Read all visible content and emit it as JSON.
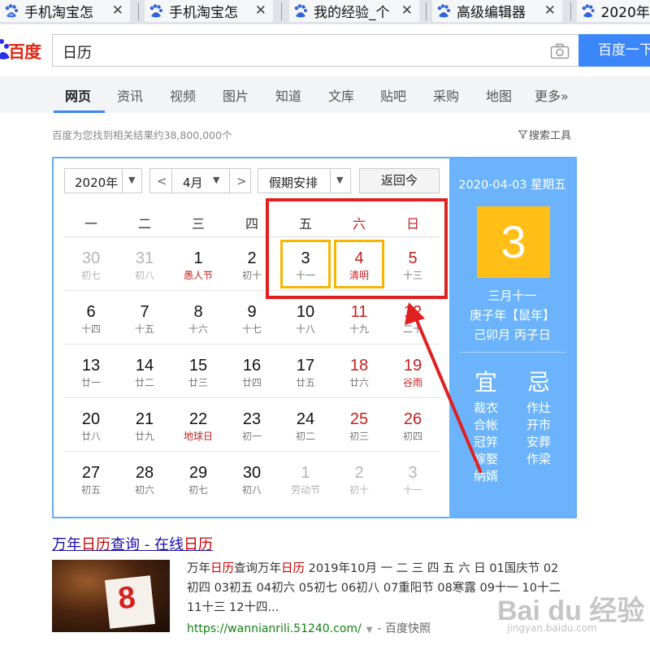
{
  "browser": {
    "tabs": [
      {
        "title": "手机淘宝怎"
      },
      {
        "title": "手机淘宝怎"
      },
      {
        "title": "我的经验_个"
      },
      {
        "title": "高级编辑器"
      },
      {
        "title": "2020年"
      }
    ],
    "tab_close": "✕"
  },
  "header": {
    "logo_text": "百度",
    "search_value": "日历",
    "search_button": "百度一下"
  },
  "nav": {
    "items": [
      "网页",
      "资讯",
      "视频",
      "图片",
      "知道",
      "文库",
      "贴吧",
      "采购",
      "地图",
      "更多»"
    ]
  },
  "results": {
    "count_text": "百度为您找到相关结果约38,800,000个",
    "tools_label": "搜索工具"
  },
  "calendar": {
    "year_select": "2020年",
    "month_select": "4月",
    "prev": "<",
    "next": ">",
    "holiday_select": "假期安排",
    "today_button": "返回今",
    "weekdays": [
      "一",
      "二",
      "三",
      "四",
      "五",
      "六",
      "日"
    ],
    "weeks": [
      [
        {
          "num": "30",
          "lunar": "初七",
          "other": true
        },
        {
          "num": "31",
          "lunar": "初八",
          "other": true
        },
        {
          "num": "1",
          "lunar": "愚人节",
          "festival": true
        },
        {
          "num": "2",
          "lunar": "初十"
        },
        {
          "num": "3",
          "lunar": "十一",
          "boxed": true
        },
        {
          "num": "4",
          "lunar": "清明",
          "festival": true,
          "weekend": true,
          "boxed": true
        },
        {
          "num": "5",
          "lunar": "十三",
          "weekend": true
        }
      ],
      [
        {
          "num": "6",
          "lunar": "十四"
        },
        {
          "num": "7",
          "lunar": "十五"
        },
        {
          "num": "8",
          "lunar": "十六"
        },
        {
          "num": "9",
          "lunar": "十七"
        },
        {
          "num": "10",
          "lunar": "十八"
        },
        {
          "num": "11",
          "lunar": "十九",
          "weekend": true
        },
        {
          "num": "12",
          "lunar": "二十",
          "weekend": true
        }
      ],
      [
        {
          "num": "13",
          "lunar": "廿一"
        },
        {
          "num": "14",
          "lunar": "廿二"
        },
        {
          "num": "15",
          "lunar": "廿三"
        },
        {
          "num": "16",
          "lunar": "廿四"
        },
        {
          "num": "17",
          "lunar": "廿五"
        },
        {
          "num": "18",
          "lunar": "廿六",
          "weekend": true
        },
        {
          "num": "19",
          "lunar": "谷雨",
          "festival": true,
          "weekend": true
        }
      ],
      [
        {
          "num": "20",
          "lunar": "廿八"
        },
        {
          "num": "21",
          "lunar": "廿九"
        },
        {
          "num": "22",
          "lunar": "地球日",
          "festival": true
        },
        {
          "num": "23",
          "lunar": "初一"
        },
        {
          "num": "24",
          "lunar": "初二"
        },
        {
          "num": "25",
          "lunar": "初三",
          "weekend": true
        },
        {
          "num": "26",
          "lunar": "初四",
          "weekend": true
        }
      ],
      [
        {
          "num": "27",
          "lunar": "初五"
        },
        {
          "num": "28",
          "lunar": "初六"
        },
        {
          "num": "29",
          "lunar": "初七"
        },
        {
          "num": "30",
          "lunar": "初八"
        },
        {
          "num": "1",
          "lunar": "劳动节",
          "other": true
        },
        {
          "num": "2",
          "lunar": "初十",
          "other": true
        },
        {
          "num": "3",
          "lunar": "十一",
          "other": true
        }
      ]
    ],
    "side": {
      "date": "2020-04-03 星期五",
      "day": "3",
      "lunar_date": "三月十一",
      "ganzhi_year": "庚子年【鼠年】",
      "ganzhi_month_day": "己卯月 丙子日",
      "yi_title": "宜",
      "ji_title": "忌",
      "yi_items": [
        "裁衣",
        "合帐",
        "冠笄",
        "嫁娶",
        "纳婿"
      ],
      "ji_items": [
        "作灶",
        "开市",
        "安葬",
        "作梁"
      ]
    }
  },
  "result": {
    "title_parts": [
      "万年",
      "日历",
      "查询 - 在线",
      "日历"
    ],
    "thumb_digit": "8",
    "snippet_parts": [
      "万年",
      "日历",
      "查询万年",
      "日历",
      " 2019年10月 一 二 三 四 五 六 日 01国庆节 02初四 03初五 04初六 05初七 06初八 07重阳节 08寒露 09十一 10十二 11十三 12十四..."
    ],
    "url": "https://wannianrili.51240.com/",
    "snapshot": "百度快照"
  },
  "watermark": {
    "text": "Bai du 经验",
    "sub": "jingyan.baidu.com"
  },
  "colors": {
    "accent_blue": "#3b86f8",
    "calendar_side": "#6bb4fb",
    "today_yellow": "#ffbf16",
    "weekend_red": "#c81f1f",
    "annotation_red": "#e02020"
  }
}
